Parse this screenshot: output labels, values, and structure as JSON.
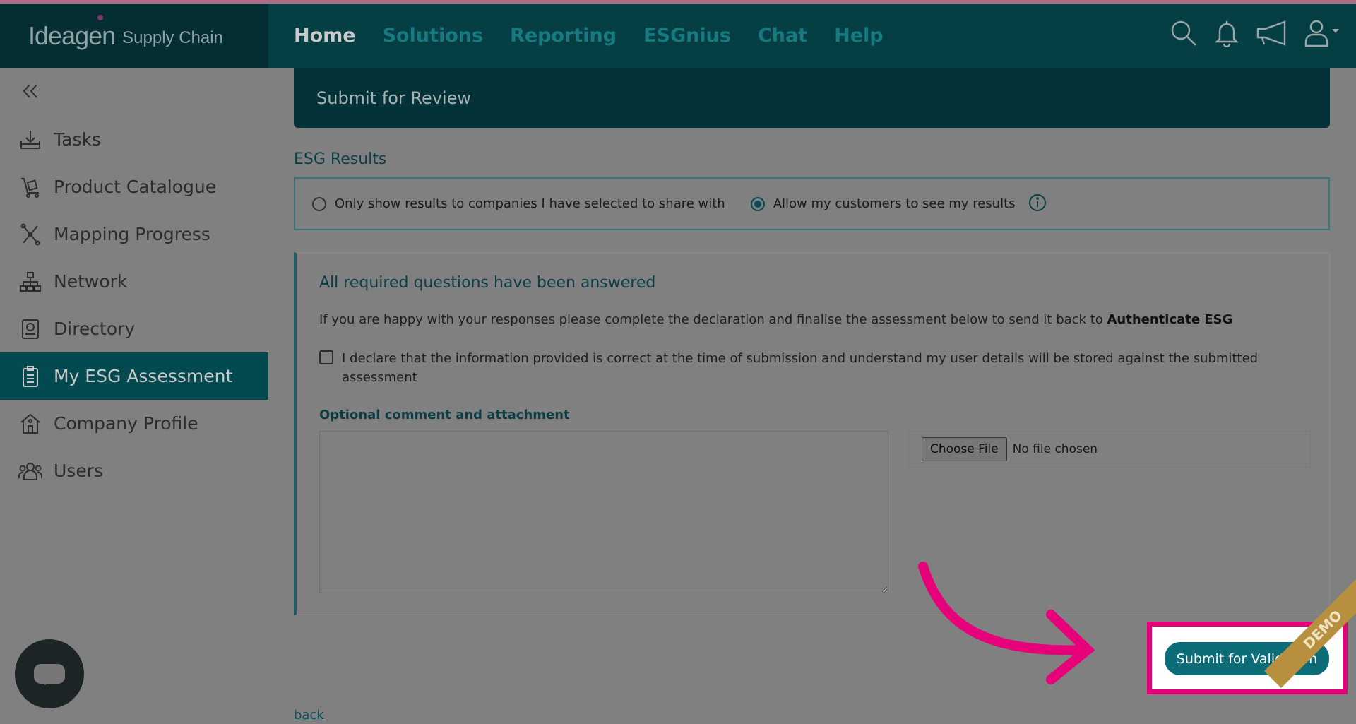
{
  "brand": {
    "name": "Ideagen",
    "product": "Supply Chain"
  },
  "nav": {
    "items": [
      {
        "label": "Home",
        "active": true
      },
      {
        "label": "Solutions"
      },
      {
        "label": "Reporting"
      },
      {
        "label": "ESGnius"
      },
      {
        "label": "Chat"
      },
      {
        "label": "Help"
      }
    ],
    "icons": [
      "search-icon",
      "bell-icon",
      "megaphone-icon",
      "user-icon"
    ]
  },
  "sidebar": {
    "items": [
      {
        "label": "Tasks",
        "icon": "download-tray-icon"
      },
      {
        "label": "Product Catalogue",
        "icon": "trolley-icon"
      },
      {
        "label": "Mapping Progress",
        "icon": "mapping-icon"
      },
      {
        "label": "Network",
        "icon": "network-icon"
      },
      {
        "label": "Directory",
        "icon": "directory-icon"
      },
      {
        "label": "My ESG Assessment",
        "icon": "clipboard-icon",
        "active": true
      },
      {
        "label": "Company Profile",
        "icon": "building-icon"
      },
      {
        "label": "Users",
        "icon": "users-icon"
      }
    ]
  },
  "main": {
    "header": "Submit for Review",
    "esg_results_label": "ESG Results",
    "visibility_options": [
      {
        "label": "Only show results to companies I have selected to share with",
        "selected": false
      },
      {
        "label": "Allow my customers to see my results",
        "selected": true
      }
    ],
    "panel": {
      "title": "All required questions have been answered",
      "description": "If you are happy with your responses please complete the declaration and finalise the assessment below to send it back to",
      "recipient": "Authenticate ESG",
      "declaration": "I declare that the information provided is correct at the time of submission and understand my user details will be stored against the submitted assessment",
      "optional_label": "Optional comment and attachment",
      "choose_file": "Choose File",
      "no_file": "No file chosen"
    },
    "submit_label": "Submit for Validation",
    "back_label": "back",
    "demo_label": "DEMO"
  },
  "colors": {
    "topbar": "#063f43",
    "active_sidebar": "#034a50",
    "submit_button": "#0c6c78",
    "highlight": "#e6007a"
  }
}
